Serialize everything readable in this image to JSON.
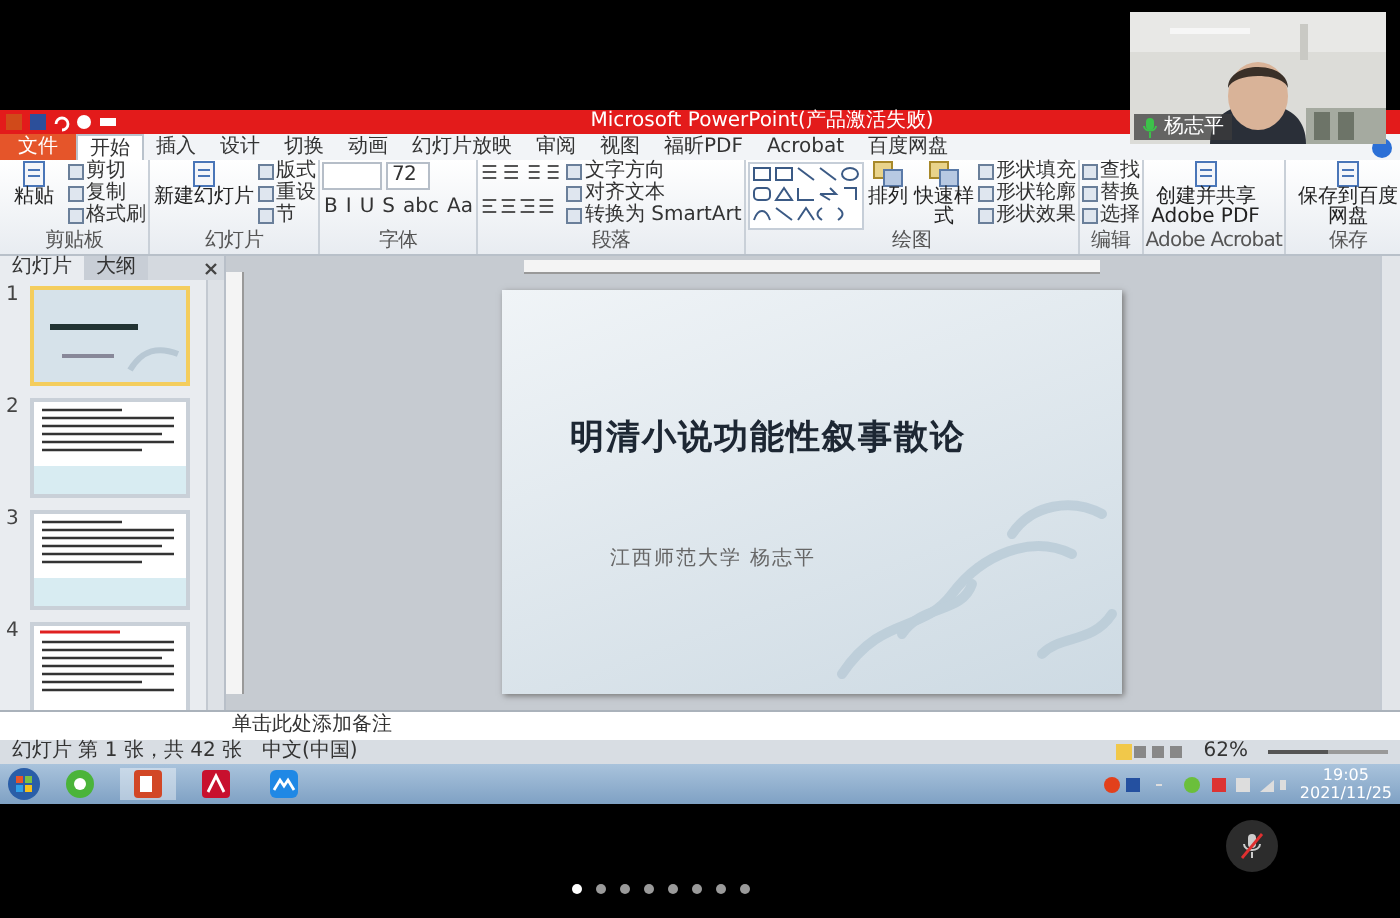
{
  "window": {
    "title": "Microsoft PowerPoint(产品激活失败)"
  },
  "ribbon_tabs": [
    {
      "label": "文件",
      "kind": "file",
      "selected": false
    },
    {
      "label": "开始",
      "kind": "tab",
      "selected": true
    },
    {
      "label": "插入",
      "kind": "tab",
      "selected": false
    },
    {
      "label": "设计",
      "kind": "tab",
      "selected": false
    },
    {
      "label": "切换",
      "kind": "tab",
      "selected": false
    },
    {
      "label": "动画",
      "kind": "tab",
      "selected": false
    },
    {
      "label": "幻灯片放映",
      "kind": "tab",
      "selected": false
    },
    {
      "label": "审阅",
      "kind": "tab",
      "selected": false
    },
    {
      "label": "视图",
      "kind": "tab",
      "selected": false
    },
    {
      "label": "福昕PDF",
      "kind": "tab",
      "selected": false
    },
    {
      "label": "Acrobat",
      "kind": "tab",
      "selected": false
    },
    {
      "label": "百度网盘",
      "kind": "tab",
      "selected": false
    }
  ],
  "ribbon_groups": [
    {
      "kind": "buttons",
      "label": "剪贴板",
      "large": [
        "粘贴"
      ],
      "small": [
        "剪切",
        "复制",
        "格式刷"
      ]
    },
    {
      "kind": "buttons",
      "label": "幻灯片",
      "large": [
        "新建幻灯片"
      ],
      "small": [
        "版式",
        "重设",
        "节"
      ]
    },
    {
      "kind": "font",
      "label": "字体",
      "size": "72",
      "format_buttons": [
        "B",
        "I",
        "U",
        "S",
        "abc",
        "Aa"
      ]
    },
    {
      "kind": "paragraph",
      "label": "段落",
      "small": [
        "文字方向",
        "对齐文本",
        "转换为 SmartArt"
      ]
    },
    {
      "kind": "drawing",
      "label": "绘图",
      "large": [
        "排列",
        "快速样式"
      ],
      "small": [
        "形状填充",
        "形状轮廓",
        "形状效果"
      ]
    },
    {
      "kind": "buttons",
      "label": "编辑",
      "small": [
        "查找",
        "替换",
        "选择"
      ]
    },
    {
      "kind": "buttons",
      "label": "Adobe Acrobat",
      "large": [
        "创建并共享 Adobe PDF"
      ]
    },
    {
      "kind": "buttons",
      "label": "保存",
      "large": [
        "保存到百度网盘"
      ]
    }
  ],
  "slide_panel": {
    "tabs": [
      {
        "label": "幻灯片",
        "selected": true
      },
      {
        "label": "大纲",
        "selected": false
      }
    ],
    "slides": [
      {
        "number": "1",
        "selected": true,
        "kind": "title"
      },
      {
        "number": "2",
        "selected": false,
        "kind": "text"
      },
      {
        "number": "3",
        "selected": false,
        "kind": "text"
      },
      {
        "number": "4",
        "selected": false,
        "kind": "red_heading"
      }
    ]
  },
  "slide": {
    "title": "明清小说功能性叙事散论",
    "subtitle": "江西师范大学 杨志平"
  },
  "notes": {
    "placeholder": "单击此处添加备注"
  },
  "status_bar": {
    "slide_info": "幻灯片 第 1 张，共 42 张",
    "language": "中文(中国)",
    "zoom": "62%",
    "zoom_slider": {
      "level": 0.5
    }
  },
  "taskbar": {
    "time": "19:05",
    "date": "2021/11/25"
  },
  "video_call": {
    "participant": {
      "name": "杨志平"
    },
    "mic_muted": true,
    "page_dots": [
      {
        "selected": true
      },
      {
        "selected": false
      },
      {
        "selected": false
      },
      {
        "selected": false
      },
      {
        "selected": false
      },
      {
        "selected": false
      },
      {
        "selected": false
      },
      {
        "selected": false
      }
    ]
  }
}
